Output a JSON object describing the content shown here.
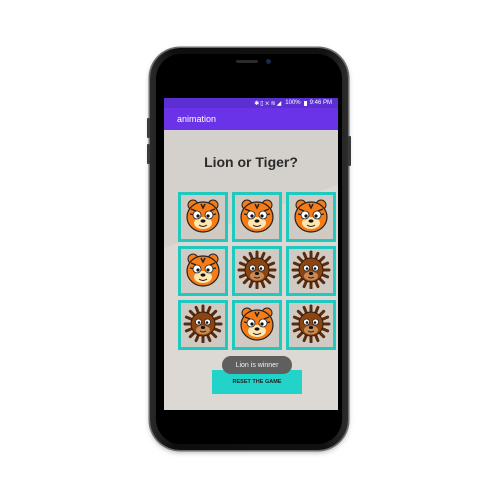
{
  "status_bar": {
    "icons": [
      "bluetooth-icon",
      "vibrate-icon",
      "mute-icon",
      "wifi-icon",
      "signal-icon"
    ],
    "battery": "100%",
    "time": "9:46 PM"
  },
  "app_bar": {
    "title": "animation"
  },
  "game": {
    "title": "Lion or Tiger?",
    "board": [
      [
        "tiger",
        "tiger",
        "tiger"
      ],
      [
        "tiger",
        "lion",
        "lion"
      ],
      [
        "lion",
        "tiger",
        "lion"
      ]
    ],
    "reset_label": "RESET THE GAME",
    "toast": "Lion is winner"
  },
  "colors": {
    "status_bar": "#5b2fd1",
    "app_bar": "#6a33e8",
    "accent": "#1fc9bd",
    "tiger": "#f57c16",
    "lion": "#8b4513"
  }
}
